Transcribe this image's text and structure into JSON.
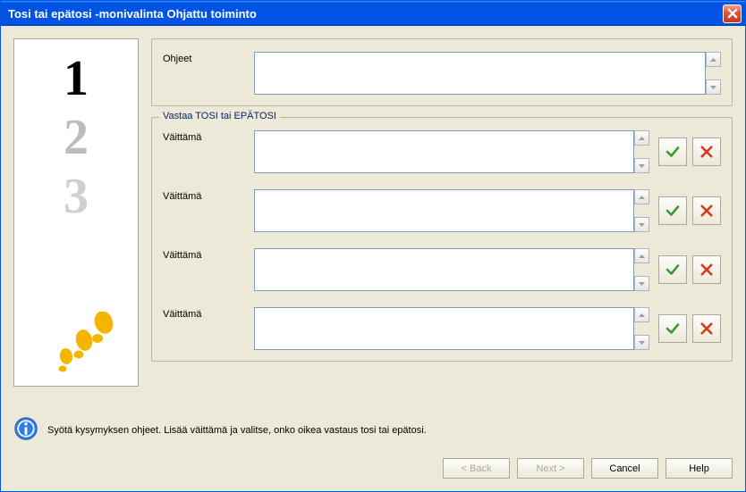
{
  "window": {
    "title": "Tosi tai epätosi -monivalinta Ohjattu toiminto"
  },
  "colors": {
    "titlebar": "#0054e3",
    "legend": "#0a246a",
    "check": "#3d9b35",
    "cross": "#d43a1e"
  },
  "labels": {
    "ohjeet": "Ohjeet",
    "section_legend": "Vastaa TOSI tai EPÄTOSI",
    "claim": "Väittämä"
  },
  "values": {
    "ohjeet_text": "",
    "claims": [
      "",
      "",
      "",
      ""
    ]
  },
  "info": {
    "text": "Syötä kysymyksen ohjeet. Lisää väittämä ja valitse, onko oikea vastaus tosi tai epätosi."
  },
  "buttons": {
    "back": "< Back",
    "next": "Next >",
    "cancel": "Cancel",
    "help": "Help"
  },
  "side": {
    "digits": [
      "1",
      "2",
      "3"
    ]
  }
}
